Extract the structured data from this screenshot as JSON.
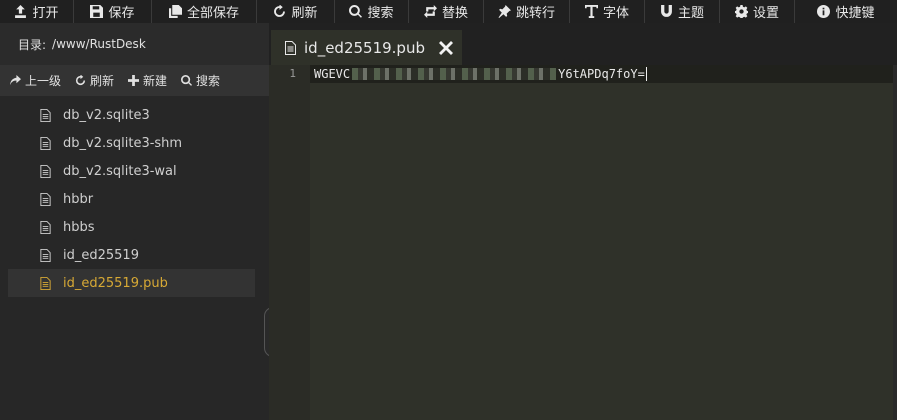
{
  "toolbar": {
    "open": "打开",
    "save": "保存",
    "save_all": "全部保存",
    "refresh": "刷新",
    "search": "搜索",
    "replace": "替换",
    "goto_line": "跳转行",
    "font": "字体",
    "theme": "主题",
    "settings": "设置",
    "shortcuts": "快捷键"
  },
  "sidebar": {
    "dir_label": "目录:",
    "dir_path": "/www/RustDesk",
    "actions": {
      "up": "上一级",
      "refresh": "刷新",
      "new": "新建",
      "search": "搜索"
    },
    "files": [
      {
        "name": "db_v2.sqlite3"
      },
      {
        "name": "db_v2.sqlite3-shm"
      },
      {
        "name": "db_v2.sqlite3-wal"
      },
      {
        "name": "hbbr"
      },
      {
        "name": "hbbs"
      },
      {
        "name": "id_ed25519"
      },
      {
        "name": "id_ed25519.pub",
        "active": true
      }
    ]
  },
  "tab": {
    "title": "id_ed25519.pub"
  },
  "editor": {
    "line_number": "1",
    "line_start": "WGEVC",
    "line_end": "Y6tAPDq7foY="
  },
  "colors": {
    "toolbar_bg": "#202020",
    "sidebar_bg": "#272727",
    "editor_bg": "#2f3129",
    "active_file": "#d7a935"
  }
}
